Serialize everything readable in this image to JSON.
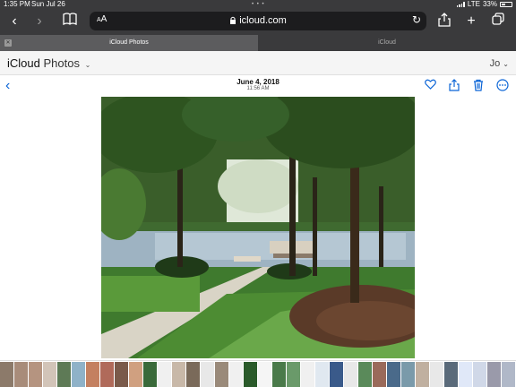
{
  "status": {
    "time": "1:35 PM",
    "date": "Sun Jul 26",
    "multitask_dots": "• • •",
    "network": "LTE",
    "battery": "33%"
  },
  "toolbar": {
    "back_icon": "chevron-left-icon",
    "forward_icon": "chevron-right-icon",
    "bookmarks_icon": "book-icon",
    "text_size": "AA",
    "url": "icloud.com",
    "reload_icon": "reload-icon",
    "share_icon": "share-icon",
    "new_tab_icon": "plus-icon",
    "tabs_icon": "tabs-icon"
  },
  "tabs": [
    {
      "label": "iCloud Photos",
      "active": true
    },
    {
      "label": "iCloud",
      "active": false
    }
  ],
  "app": {
    "brand": "iCloud",
    "section": "Photos",
    "user": "Jo"
  },
  "photo": {
    "date": "June 4, 2018",
    "time": "11:56 AM",
    "actions": [
      "heart-icon",
      "share-icon",
      "trash-icon",
      "more-icon"
    ]
  },
  "filmstrip": {
    "thumb_colors": [
      "#8c7a6a",
      "#a88c7a",
      "#b59480",
      "#d2c4b8",
      "#5e7a56",
      "#8fb2c8",
      "#c48060",
      "#b06a5a",
      "#7a5a4a",
      "#d0a080",
      "#3a6a3a",
      "#f0f0f0",
      "#c8b8a8",
      "#7a6a5a",
      "#e8e8e8",
      "#9a8a7a",
      "#f0f0f0",
      "#2a5a2a",
      "#f5f5f5",
      "#4a7a4a",
      "#6a9a6a",
      "#f0f0f0",
      "#e0e8f0",
      "#3a5a8a",
      "#e8e8e8",
      "#5a8a5a",
      "#9a6a5a",
      "#4a6a8a",
      "#7a9aaa",
      "#c0b0a0",
      "#e8e8e8",
      "#5a6a7a",
      "#e0e8f8",
      "#d0d8e8",
      "#9a9aaa",
      "#b0b8c8"
    ]
  }
}
